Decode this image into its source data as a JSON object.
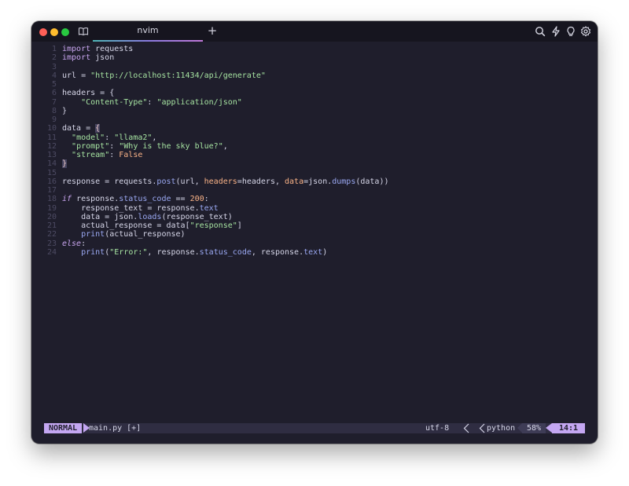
{
  "window": {
    "tab_title": "nvim",
    "new_tab_label": "+",
    "titlebar_icons": [
      "book-icon",
      "search-icon",
      "lightning-icon",
      "bulb-icon",
      "gear-icon"
    ]
  },
  "editor": {
    "lines": [
      {
        "n": "1"
      },
      {
        "n": "2"
      },
      {
        "n": "3"
      },
      {
        "n": "4"
      },
      {
        "n": "5"
      },
      {
        "n": "6"
      },
      {
        "n": "7"
      },
      {
        "n": "8"
      },
      {
        "n": "9"
      },
      {
        "n": "10"
      },
      {
        "n": "11"
      },
      {
        "n": "12"
      },
      {
        "n": "13"
      },
      {
        "n": "14"
      },
      {
        "n": "15"
      },
      {
        "n": "16"
      },
      {
        "n": "17"
      },
      {
        "n": "18"
      },
      {
        "n": "19"
      },
      {
        "n": "20"
      },
      {
        "n": "21"
      },
      {
        "n": "22"
      },
      {
        "n": "23"
      },
      {
        "n": "24"
      }
    ],
    "tokens": {
      "l1_kw": "import",
      "l1_mod": " requests",
      "l2_kw": "import",
      "l2_mod": " json",
      "l4_a": "url = ",
      "l4_str": "\"http://localhost:11434/api/generate\"",
      "l6_a": "headers = ",
      "l6_b": "{",
      "l7_a": "    ",
      "l7_key": "\"Content-Type\"",
      "l7_b": ": ",
      "l7_val": "\"application/json\"",
      "l8_a": "}",
      "l10_a": "data = ",
      "l10_b": "{",
      "l11_a": "  ",
      "l11_key": "\"model\"",
      "l11_b": ": ",
      "l11_val": "\"llama2\"",
      "l11_c": ",",
      "l12_a": "  ",
      "l12_key": "\"prompt\"",
      "l12_b": ": ",
      "l12_val": "\"Why is the sky blue?\"",
      "l12_c": ",",
      "l13_a": "  ",
      "l13_key": "\"stream\"",
      "l13_b": ": ",
      "l13_val": "False",
      "l14_a": "}",
      "l16_a": "response = requests.",
      "l16_fn": "post",
      "l16_b": "(url, ",
      "l16_p1": "headers",
      "l16_c": "=headers, ",
      "l16_p2": "data",
      "l16_d": "=json.",
      "l16_fn2": "dumps",
      "l16_e": "(data))",
      "l18_kw": "if",
      "l18_a": " response.",
      "l18_prop": "status_code",
      "l18_b": " == ",
      "l18_num": "200",
      "l18_c": ":",
      "l19_a": "    response_text = response.",
      "l19_prop": "text",
      "l20_a": "    data = json.",
      "l20_fn": "loads",
      "l20_b": "(response_text)",
      "l21_a": "    actual_response = data[",
      "l21_str": "\"response\"",
      "l21_b": "]",
      "l22_a": "    ",
      "l22_fn": "print",
      "l22_b": "(actual_response)",
      "l23_kw": "else",
      "l23_a": ":",
      "l24_a": "    ",
      "l24_fn": "print",
      "l24_b": "(",
      "l24_str": "\"Error:\"",
      "l24_c": ", response.",
      "l24_prop": "status_code",
      "l24_d": ", response.",
      "l24_prop2": "text",
      "l24_e": ")"
    }
  },
  "statusbar": {
    "mode": "NORMAL",
    "file": "main.py [+]",
    "encoding": "utf-8",
    "filetype": "python",
    "percent": "58%",
    "position": "14:1"
  },
  "colors": {
    "background": "#1f1e2c",
    "accent": "#c4a7f2"
  }
}
